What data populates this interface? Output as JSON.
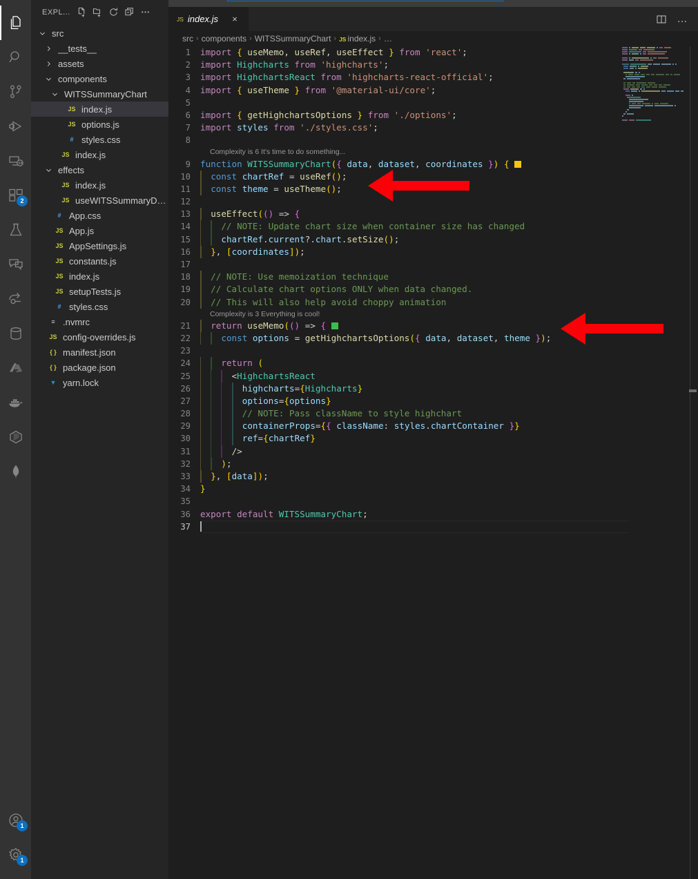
{
  "window": {
    "app": "Visual Studio Code"
  },
  "activitybar": {
    "items": [
      {
        "name": "explorer",
        "title": "Explorer",
        "active": true,
        "badge": null
      },
      {
        "name": "search",
        "title": "Search",
        "active": false,
        "badge": null
      },
      {
        "name": "source-control",
        "title": "Source Control",
        "active": false,
        "badge": null
      },
      {
        "name": "run-and-debug",
        "title": "Run and Debug",
        "active": false,
        "badge": null
      },
      {
        "name": "remote-explorer",
        "title": "Remote Explorer",
        "active": false,
        "badge": null
      },
      {
        "name": "extensions",
        "title": "Extensions",
        "active": false,
        "badge": "2"
      },
      {
        "name": "testing",
        "title": "Testing",
        "active": false,
        "badge": null
      },
      {
        "name": "comments",
        "title": "Comments",
        "active": false,
        "badge": null
      },
      {
        "name": "live-share",
        "title": "Live Share",
        "active": false,
        "badge": null
      },
      {
        "name": "database",
        "title": "Database",
        "active": false,
        "badge": null
      },
      {
        "name": "azure",
        "title": "Azure",
        "active": false,
        "badge": null
      },
      {
        "name": "docker",
        "title": "Docker",
        "active": false,
        "badge": null
      },
      {
        "name": "packages",
        "title": "Packages",
        "active": false,
        "badge": null
      },
      {
        "name": "mongodb",
        "title": "MongoDB",
        "active": false,
        "badge": null
      }
    ],
    "bottom": [
      {
        "name": "accounts",
        "title": "Accounts",
        "badge": "1"
      },
      {
        "name": "manage-settings",
        "title": "Manage",
        "badge": "1"
      }
    ]
  },
  "sidebar": {
    "title": "EXPL...",
    "actions": [
      {
        "name": "new-file-icon",
        "title": "New File"
      },
      {
        "name": "new-folder-icon",
        "title": "New Folder"
      },
      {
        "name": "refresh-icon",
        "title": "Refresh Explorer"
      },
      {
        "name": "collapse-all-icon",
        "title": "Collapse Folders in Explorer"
      },
      {
        "name": "more-actions-icon",
        "title": "Views and More Actions..."
      }
    ],
    "tree": [
      {
        "label": "src",
        "indent": 0,
        "type": "folder",
        "state": "expanded",
        "icon": "folder"
      },
      {
        "label": "__tests__",
        "indent": 1,
        "type": "folder",
        "state": "collapsed",
        "icon": "folder"
      },
      {
        "label": "assets",
        "indent": 1,
        "type": "folder",
        "state": "collapsed",
        "icon": "folder"
      },
      {
        "label": "components",
        "indent": 1,
        "type": "folder",
        "state": "expanded",
        "icon": "folder"
      },
      {
        "label": "WITSSummaryChart",
        "indent": 2,
        "type": "folder",
        "state": "expanded",
        "icon": "folder"
      },
      {
        "label": "index.js",
        "indent": 3,
        "type": "file",
        "icon": "js",
        "selected": true
      },
      {
        "label": "options.js",
        "indent": 3,
        "type": "file",
        "icon": "js"
      },
      {
        "label": "styles.css",
        "indent": 3,
        "type": "file",
        "icon": "css"
      },
      {
        "label": "index.js",
        "indent": 2,
        "type": "file",
        "icon": "js"
      },
      {
        "label": "effects",
        "indent": 1,
        "type": "folder",
        "state": "expanded",
        "icon": "folder"
      },
      {
        "label": "index.js",
        "indent": 2,
        "type": "file",
        "icon": "js"
      },
      {
        "label": "useWITSSummaryData...",
        "indent": 2,
        "type": "file",
        "icon": "js"
      },
      {
        "label": "App.css",
        "indent": 1,
        "type": "file",
        "icon": "css"
      },
      {
        "label": "App.js",
        "indent": 1,
        "type": "file",
        "icon": "js"
      },
      {
        "label": "AppSettings.js",
        "indent": 1,
        "type": "file",
        "icon": "js"
      },
      {
        "label": "constants.js",
        "indent": 1,
        "type": "file",
        "icon": "js"
      },
      {
        "label": "index.js",
        "indent": 1,
        "type": "file",
        "icon": "js"
      },
      {
        "label": "setupTests.js",
        "indent": 1,
        "type": "file",
        "icon": "js"
      },
      {
        "label": "styles.css",
        "indent": 1,
        "type": "file",
        "icon": "css"
      },
      {
        "label": ".nvmrc",
        "indent": 0,
        "type": "file",
        "icon": "cfg"
      },
      {
        "label": "config-overrides.js",
        "indent": 0,
        "type": "file",
        "icon": "js"
      },
      {
        "label": "manifest.json",
        "indent": 0,
        "type": "file",
        "icon": "json"
      },
      {
        "label": "package.json",
        "indent": 0,
        "type": "file",
        "icon": "json"
      },
      {
        "label": "yarn.lock",
        "indent": 0,
        "type": "file",
        "icon": "yarn"
      }
    ]
  },
  "tabs": {
    "active": {
      "label": "index.js",
      "icon": "js",
      "preview": true,
      "close_glyph": "×"
    },
    "actions": [
      {
        "name": "split-editor-icon",
        "title": "Split Editor Right"
      },
      {
        "name": "editor-more-actions-icon",
        "title": "More Actions...",
        "glyph": "…"
      }
    ]
  },
  "breadcrumb": {
    "separator": "›",
    "items": [
      {
        "label": "src",
        "icon": null
      },
      {
        "label": "components",
        "icon": null
      },
      {
        "label": "WITSSummaryChart",
        "icon": null
      },
      {
        "label": "index.js",
        "icon": "js"
      },
      {
        "label": "…",
        "icon": null
      }
    ]
  },
  "editor": {
    "language": "JavaScript",
    "cursor_line": 37,
    "total_lines": 37,
    "codelens": [
      {
        "above_line": 9,
        "text": "Complexity is 6 It's time to do something..."
      },
      {
        "above_line": 21,
        "text": "Complexity is 3 Everything is cool!"
      }
    ],
    "inline_markers": [
      {
        "line": 9,
        "color": "#f5c518",
        "meaning": "complexity-warning"
      },
      {
        "line": 21,
        "color": "#3fba50",
        "meaning": "complexity-ok"
      }
    ],
    "lines": [
      {
        "n": 1,
        "text": "import { useMemo, useRef, useEffect } from 'react';"
      },
      {
        "n": 2,
        "text": "import Highcharts from 'highcharts';"
      },
      {
        "n": 3,
        "text": "import HighchartsReact from 'highcharts-react-official';"
      },
      {
        "n": 4,
        "text": "import { useTheme } from '@material-ui/core';"
      },
      {
        "n": 5,
        "text": ""
      },
      {
        "n": 6,
        "text": "import { getHighchartsOptions } from './options';"
      },
      {
        "n": 7,
        "text": "import styles from './styles.css';"
      },
      {
        "n": 8,
        "text": ""
      },
      {
        "n": 9,
        "text": "function WITSSummaryChart({ data, dataset, coordinates }) {"
      },
      {
        "n": 10,
        "text": "  const chartRef = useRef();"
      },
      {
        "n": 11,
        "text": "  const theme = useTheme();"
      },
      {
        "n": 12,
        "text": ""
      },
      {
        "n": 13,
        "text": "  useEffect(() => {"
      },
      {
        "n": 14,
        "text": "    // NOTE: Update chart size when container size has changed"
      },
      {
        "n": 15,
        "text": "    chartRef.current?.chart.setSize();"
      },
      {
        "n": 16,
        "text": "  }, [coordinates]);"
      },
      {
        "n": 17,
        "text": ""
      },
      {
        "n": 18,
        "text": "  // NOTE: Use memoization technique"
      },
      {
        "n": 19,
        "text": "  // Calculate chart options ONLY when data changed."
      },
      {
        "n": 20,
        "text": "  // This will also help avoid choppy animation"
      },
      {
        "n": 21,
        "text": "  return useMemo(() => {"
      },
      {
        "n": 22,
        "text": "    const options = getHighchartsOptions({ data, dataset, theme });"
      },
      {
        "n": 23,
        "text": ""
      },
      {
        "n": 24,
        "text": "    return ("
      },
      {
        "n": 25,
        "text": "      <HighchartsReact"
      },
      {
        "n": 26,
        "text": "        highcharts={Highcharts}"
      },
      {
        "n": 27,
        "text": "        options={options}"
      },
      {
        "n": 28,
        "text": "        // NOTE: Pass className to style highchart"
      },
      {
        "n": 29,
        "text": "        containerProps={{ className: styles.chartContainer }}"
      },
      {
        "n": 30,
        "text": "        ref={chartRef}"
      },
      {
        "n": 31,
        "text": "      />"
      },
      {
        "n": 32,
        "text": "    );"
      },
      {
        "n": 33,
        "text": "  }, [data]);"
      },
      {
        "n": 34,
        "text": "}"
      },
      {
        "n": 35,
        "text": ""
      },
      {
        "n": 36,
        "text": "export default WITSSummaryChart;"
      },
      {
        "n": 37,
        "text": ""
      }
    ]
  },
  "annotations": {
    "arrows": [
      {
        "name": "arrow-use-theme",
        "points_to_line": 11,
        "color": "#fb0007"
      },
      {
        "name": "arrow-get-options",
        "points_to_line": 22,
        "color": "#fb0007"
      }
    ]
  },
  "colors": {
    "editor_background": "#1e1e1e",
    "sidebar_background": "#252526",
    "activitybar_background": "#333333",
    "accent": "#0e70c0",
    "selection": "#37373d",
    "annotation_red": "#fb0007",
    "marker_yellow": "#f5c518",
    "marker_green": "#3fba50"
  }
}
